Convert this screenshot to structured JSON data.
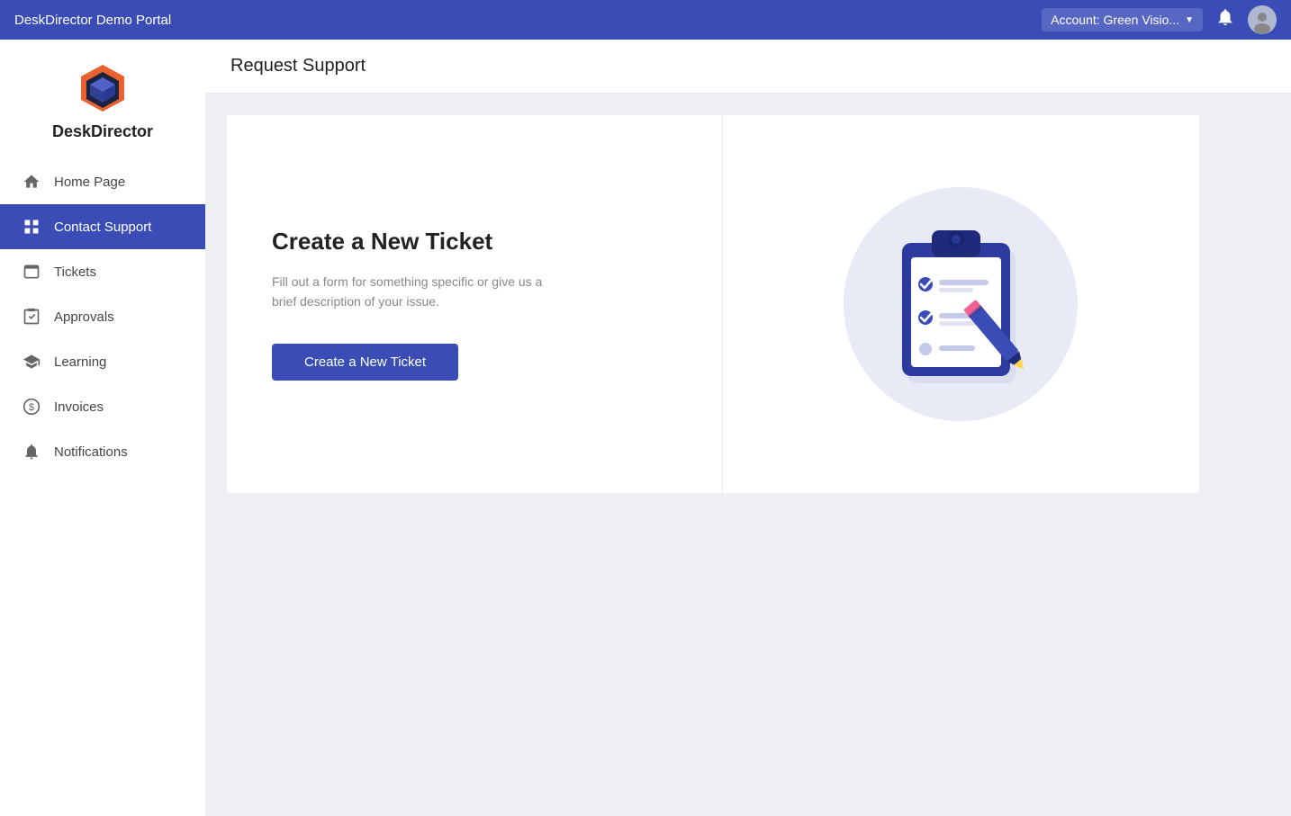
{
  "app": {
    "title": "DeskDirector Demo Portal"
  },
  "header": {
    "account_label": "Account:  Green Visio...",
    "bell_label": "notifications-bell",
    "avatar_label": "user-avatar"
  },
  "sidebar": {
    "logo_text": "DeskDirector",
    "nav_items": [
      {
        "id": "home-page",
        "label": "Home Page",
        "icon": "home",
        "active": false
      },
      {
        "id": "contact-support",
        "label": "Contact Support",
        "icon": "grid",
        "active": true
      },
      {
        "id": "tickets",
        "label": "Tickets",
        "icon": "tickets",
        "active": false
      },
      {
        "id": "approvals",
        "label": "Approvals",
        "icon": "approvals",
        "active": false
      },
      {
        "id": "learning",
        "label": "Learning",
        "icon": "learning",
        "active": false
      },
      {
        "id": "invoices",
        "label": "Invoices",
        "icon": "invoices",
        "active": false
      },
      {
        "id": "notifications",
        "label": "Notifications",
        "icon": "bell",
        "active": false
      }
    ]
  },
  "main": {
    "page_title": "Request Support",
    "card": {
      "title": "Create a New Ticket",
      "description": "Fill out a form for something specific or give us a brief description of your issue.",
      "button_label": "Create a New Ticket"
    }
  }
}
